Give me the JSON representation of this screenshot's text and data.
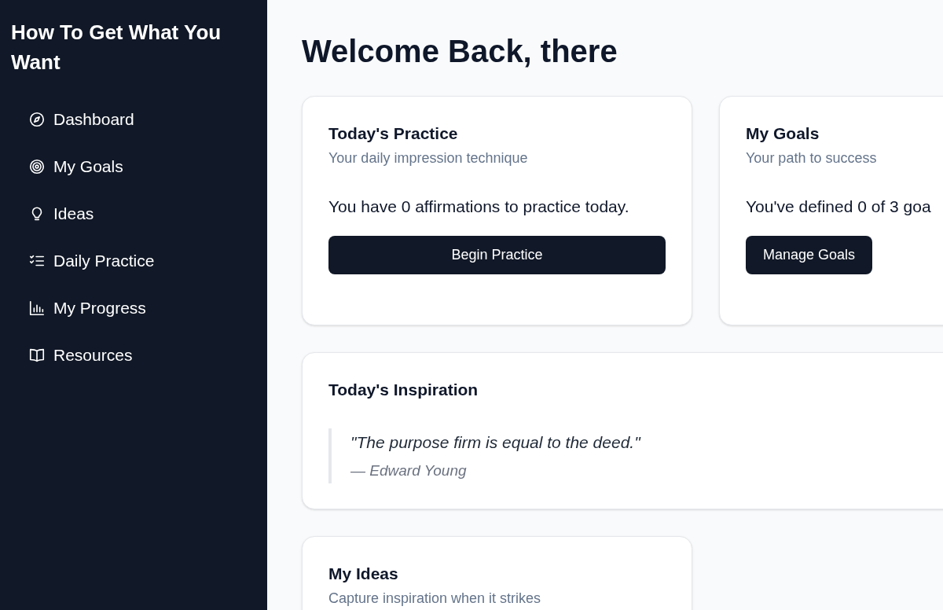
{
  "sidebar": {
    "title": "How To Get What You Want",
    "items": [
      {
        "label": "Dashboard"
      },
      {
        "label": "My Goals"
      },
      {
        "label": "Ideas"
      },
      {
        "label": "Daily Practice"
      },
      {
        "label": "My Progress"
      },
      {
        "label": "Resources"
      }
    ]
  },
  "heading": "Welcome Back, there",
  "cards": [
    {
      "kind": "action",
      "title": "Today's Practice",
      "subtitle": "Your daily impression technique",
      "body": "You have 0 affirmations to practice today.",
      "button": "Begin Practice"
    },
    {
      "kind": "action",
      "title": "My Goals",
      "subtitle": "Your path to success",
      "body": "You've defined 0 of 3 goa",
      "button": "Manage Goals"
    },
    {
      "kind": "quote",
      "title": "Today's Inspiration",
      "quote": "\"The purpose firm is equal to the deed.\"",
      "author": "— Edward Young"
    },
    {
      "kind": "plain",
      "title": "My Ideas",
      "subtitle": "Capture inspiration when it strikes"
    }
  ]
}
